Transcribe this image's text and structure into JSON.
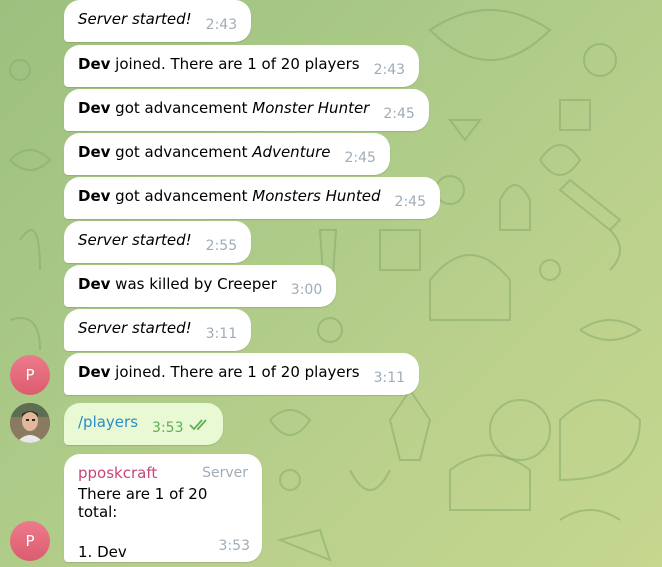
{
  "messages": [
    {
      "bold": "",
      "italic": "Server started!",
      "rest": "",
      "time": "2:43"
    },
    {
      "bold": "Dev",
      "rest": " joined. There are 1 of 20 players",
      "time": "2:43"
    },
    {
      "bold": "Dev",
      "rest": " got advancement ",
      "italic": "Monster Hunter",
      "time": "2:45"
    },
    {
      "bold": "Dev",
      "rest": " got advancement ",
      "italic": "Adventure",
      "time": "2:45"
    },
    {
      "bold": "Dev",
      "rest": " got advancement ",
      "italic": "Monsters Hunted",
      "time": "2:45"
    },
    {
      "italic": "Server started!",
      "time": "2:55"
    },
    {
      "bold": "Dev",
      "rest": " was killed by Creeper",
      "time": "3:00"
    },
    {
      "italic": "Server started!",
      "time": "3:11"
    },
    {
      "bold": "Dev",
      "rest": " joined. There are 1 of 20 players",
      "time": "3:11"
    }
  ],
  "avatars": {
    "bot_letter": "P",
    "user_photo": "user-avatar-photo"
  },
  "outgoing": {
    "text": "/players",
    "time": "3:53",
    "status_icon": "double-check-icon"
  },
  "reply": {
    "sender": "pposkcraft",
    "role": "Server",
    "line1": "There are 1 of 20 total:",
    "line2": "1. Dev",
    "time": "3:53"
  },
  "colors": {
    "sender": "#c7467a",
    "command_link": "#2a8dc7",
    "outgoing_bubble": "#e9f9d3",
    "check_marks": "#5fae55",
    "avatar": "#e06a7b"
  }
}
